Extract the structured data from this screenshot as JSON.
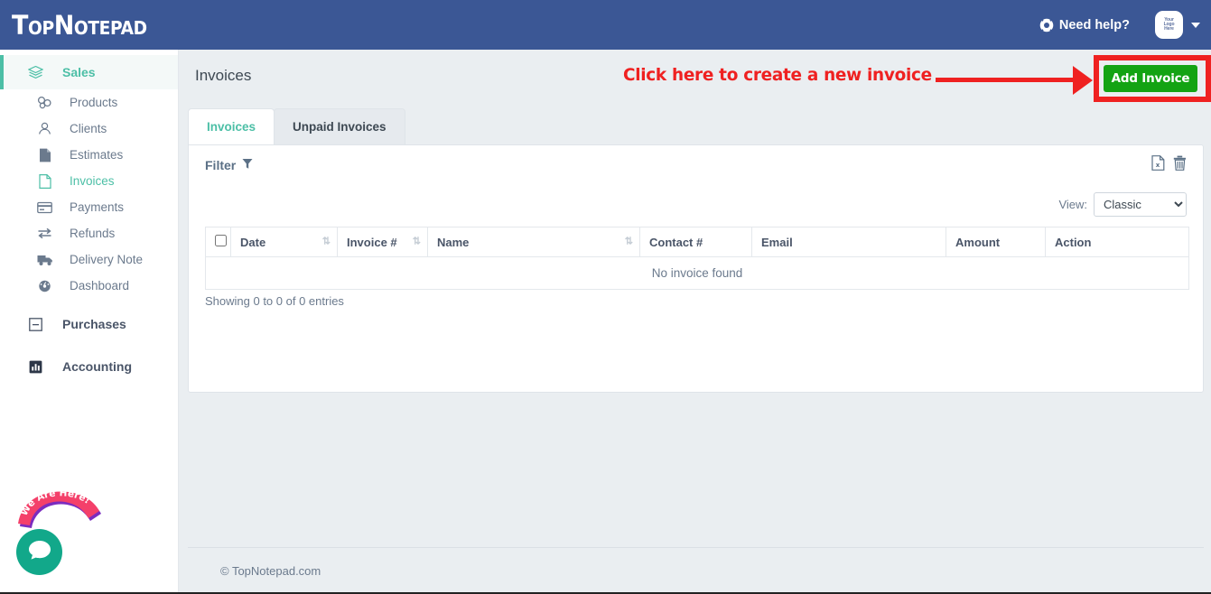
{
  "topbar": {
    "brand": "TopNotepad",
    "help_label": "Need help?",
    "help_icon": "life-ring-icon",
    "avatar_line1": "Your",
    "avatar_line2": "Logo",
    "avatar_line3": "Here",
    "caret_icon": "caret-down-icon"
  },
  "sidebar": {
    "groups": [
      {
        "label": "Sales",
        "icon": "layers-icon",
        "active": true
      },
      {
        "label": "Purchases",
        "icon": "minus-square-icon",
        "active": false
      },
      {
        "label": "Accounting",
        "icon": "chart-bar-icon",
        "active": false
      }
    ],
    "items": [
      {
        "label": "Products",
        "icon": "products-icon",
        "active": false
      },
      {
        "label": "Clients",
        "icon": "user-icon",
        "active": false
      },
      {
        "label": "Estimates",
        "icon": "document-icon",
        "active": false
      },
      {
        "label": "Invoices",
        "icon": "invoice-document-icon",
        "active": true
      },
      {
        "label": "Payments",
        "icon": "credit-card-icon",
        "active": false
      },
      {
        "label": "Refunds",
        "icon": "exchange-arrows-icon",
        "active": false
      },
      {
        "label": "Delivery Note",
        "icon": "truck-icon",
        "active": false
      },
      {
        "label": "Dashboard",
        "icon": "speedometer-icon",
        "active": false
      }
    ]
  },
  "main": {
    "page_title": "Invoices",
    "annotation_text": "Click here to create a new invoice",
    "add_invoice_label": "Add Invoice",
    "tabs": [
      {
        "label": "Invoices",
        "active": true
      },
      {
        "label": "Unpaid Invoices",
        "active": false
      }
    ],
    "filter_label": "Filter",
    "filter_icon": "funnel-icon",
    "export_icon": "excel-export-icon",
    "delete_icon": "trash-icon",
    "view_label": "View:",
    "view_value": "Classic",
    "view_options": [
      "Classic"
    ],
    "table": {
      "columns": [
        {
          "label": "Date",
          "sortable": true
        },
        {
          "label": "Invoice #",
          "sortable": true
        },
        {
          "label": "Name",
          "sortable": true
        },
        {
          "label": "Contact #",
          "sortable": false
        },
        {
          "label": "Email",
          "sortable": false
        },
        {
          "label": "Amount",
          "sortable": false
        },
        {
          "label": "Action",
          "sortable": false
        }
      ],
      "empty_message": "No invoice found",
      "rows": []
    },
    "entries_info": "Showing 0 to 0 of 0 entries"
  },
  "footer": {
    "text": "© TopNotepad.com"
  },
  "chat": {
    "banner_text": "We Are Here!",
    "icon": "chat-bubble-icon"
  },
  "colors": {
    "header_blue": "#3b5795",
    "accent_teal": "#4cbfa6",
    "button_green": "#13a313",
    "annotation_red": "#ef2121",
    "chat_teal": "#12a88a",
    "banner_pink": "#f4406a",
    "page_bg": "#eaeef1"
  }
}
